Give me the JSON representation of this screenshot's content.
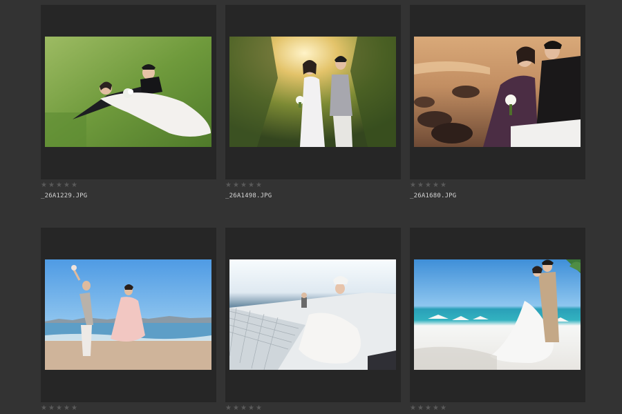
{
  "gallery": {
    "items": [
      {
        "filename": "_26A1229.JPG",
        "rating": 0,
        "scene": "couple lying on grass lawn"
      },
      {
        "filename": "_26A1498.JPG",
        "rating": 0,
        "scene": "couple walking in sunlit garden"
      },
      {
        "filename": "_26A1680.JPG",
        "rating": 0,
        "scene": "couple embracing by rocky seashore at sunset"
      },
      {
        "filename": "",
        "rating": 0,
        "scene": "couple running on beach with city skyline"
      },
      {
        "filename": "",
        "rating": 0,
        "scene": "bride sitting on catamaran net"
      },
      {
        "filename": "",
        "rating": 0,
        "scene": "couple embracing on white sand beach"
      }
    ]
  },
  "icons": {
    "rating_star": "star-icon"
  },
  "colors": {
    "background": "#333333",
    "card": "#262626",
    "star": "#5a5a5a",
    "filename_text": "#d6d6d6"
  }
}
